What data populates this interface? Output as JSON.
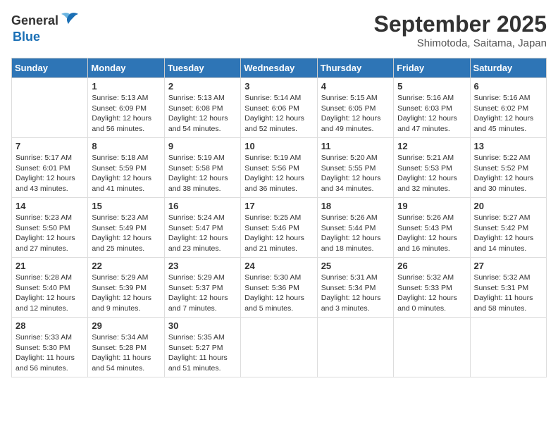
{
  "logo": {
    "general": "General",
    "blue": "Blue"
  },
  "title": "September 2025",
  "location": "Shimotoda, Saitama, Japan",
  "weekdays": [
    "Sunday",
    "Monday",
    "Tuesday",
    "Wednesday",
    "Thursday",
    "Friday",
    "Saturday"
  ],
  "weeks": [
    [
      {
        "day": "",
        "info": ""
      },
      {
        "day": "1",
        "info": "Sunrise: 5:13 AM\nSunset: 6:09 PM\nDaylight: 12 hours\nand 56 minutes."
      },
      {
        "day": "2",
        "info": "Sunrise: 5:13 AM\nSunset: 6:08 PM\nDaylight: 12 hours\nand 54 minutes."
      },
      {
        "day": "3",
        "info": "Sunrise: 5:14 AM\nSunset: 6:06 PM\nDaylight: 12 hours\nand 52 minutes."
      },
      {
        "day": "4",
        "info": "Sunrise: 5:15 AM\nSunset: 6:05 PM\nDaylight: 12 hours\nand 49 minutes."
      },
      {
        "day": "5",
        "info": "Sunrise: 5:16 AM\nSunset: 6:03 PM\nDaylight: 12 hours\nand 47 minutes."
      },
      {
        "day": "6",
        "info": "Sunrise: 5:16 AM\nSunset: 6:02 PM\nDaylight: 12 hours\nand 45 minutes."
      }
    ],
    [
      {
        "day": "7",
        "info": "Sunrise: 5:17 AM\nSunset: 6:01 PM\nDaylight: 12 hours\nand 43 minutes."
      },
      {
        "day": "8",
        "info": "Sunrise: 5:18 AM\nSunset: 5:59 PM\nDaylight: 12 hours\nand 41 minutes."
      },
      {
        "day": "9",
        "info": "Sunrise: 5:19 AM\nSunset: 5:58 PM\nDaylight: 12 hours\nand 38 minutes."
      },
      {
        "day": "10",
        "info": "Sunrise: 5:19 AM\nSunset: 5:56 PM\nDaylight: 12 hours\nand 36 minutes."
      },
      {
        "day": "11",
        "info": "Sunrise: 5:20 AM\nSunset: 5:55 PM\nDaylight: 12 hours\nand 34 minutes."
      },
      {
        "day": "12",
        "info": "Sunrise: 5:21 AM\nSunset: 5:53 PM\nDaylight: 12 hours\nand 32 minutes."
      },
      {
        "day": "13",
        "info": "Sunrise: 5:22 AM\nSunset: 5:52 PM\nDaylight: 12 hours\nand 30 minutes."
      }
    ],
    [
      {
        "day": "14",
        "info": "Sunrise: 5:23 AM\nSunset: 5:50 PM\nDaylight: 12 hours\nand 27 minutes."
      },
      {
        "day": "15",
        "info": "Sunrise: 5:23 AM\nSunset: 5:49 PM\nDaylight: 12 hours\nand 25 minutes."
      },
      {
        "day": "16",
        "info": "Sunrise: 5:24 AM\nSunset: 5:47 PM\nDaylight: 12 hours\nand 23 minutes."
      },
      {
        "day": "17",
        "info": "Sunrise: 5:25 AM\nSunset: 5:46 PM\nDaylight: 12 hours\nand 21 minutes."
      },
      {
        "day": "18",
        "info": "Sunrise: 5:26 AM\nSunset: 5:44 PM\nDaylight: 12 hours\nand 18 minutes."
      },
      {
        "day": "19",
        "info": "Sunrise: 5:26 AM\nSunset: 5:43 PM\nDaylight: 12 hours\nand 16 minutes."
      },
      {
        "day": "20",
        "info": "Sunrise: 5:27 AM\nSunset: 5:42 PM\nDaylight: 12 hours\nand 14 minutes."
      }
    ],
    [
      {
        "day": "21",
        "info": "Sunrise: 5:28 AM\nSunset: 5:40 PM\nDaylight: 12 hours\nand 12 minutes."
      },
      {
        "day": "22",
        "info": "Sunrise: 5:29 AM\nSunset: 5:39 PM\nDaylight: 12 hours\nand 9 minutes."
      },
      {
        "day": "23",
        "info": "Sunrise: 5:29 AM\nSunset: 5:37 PM\nDaylight: 12 hours\nand 7 minutes."
      },
      {
        "day": "24",
        "info": "Sunrise: 5:30 AM\nSunset: 5:36 PM\nDaylight: 12 hours\nand 5 minutes."
      },
      {
        "day": "25",
        "info": "Sunrise: 5:31 AM\nSunset: 5:34 PM\nDaylight: 12 hours\nand 3 minutes."
      },
      {
        "day": "26",
        "info": "Sunrise: 5:32 AM\nSunset: 5:33 PM\nDaylight: 12 hours\nand 0 minutes."
      },
      {
        "day": "27",
        "info": "Sunrise: 5:32 AM\nSunset: 5:31 PM\nDaylight: 11 hours\nand 58 minutes."
      }
    ],
    [
      {
        "day": "28",
        "info": "Sunrise: 5:33 AM\nSunset: 5:30 PM\nDaylight: 11 hours\nand 56 minutes."
      },
      {
        "day": "29",
        "info": "Sunrise: 5:34 AM\nSunset: 5:28 PM\nDaylight: 11 hours\nand 54 minutes."
      },
      {
        "day": "30",
        "info": "Sunrise: 5:35 AM\nSunset: 5:27 PM\nDaylight: 11 hours\nand 51 minutes."
      },
      {
        "day": "",
        "info": ""
      },
      {
        "day": "",
        "info": ""
      },
      {
        "day": "",
        "info": ""
      },
      {
        "day": "",
        "info": ""
      }
    ]
  ]
}
